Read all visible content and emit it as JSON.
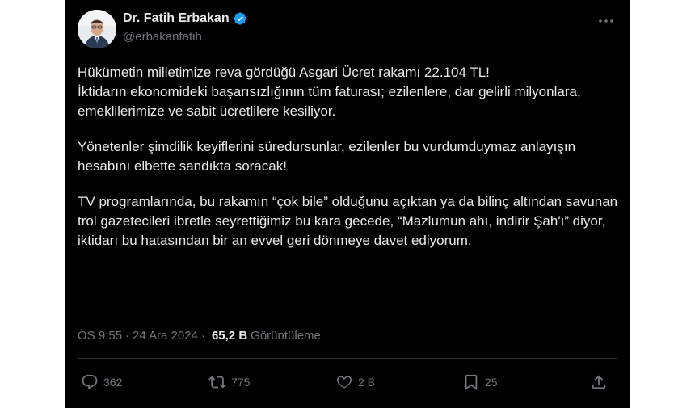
{
  "author": {
    "name": "Dr. Fatih Erbakan",
    "handle": "@erbakanfatih"
  },
  "tweet": {
    "paragraphs": [
      "Hükümetin milletimize reva gördüğü Asgari Ücret rakamı 22.104 TL!\nİktidarın ekonomideki başarısızlığının tüm faturası; ezilenlere, dar gelirli milyonlara, emeklilerimize ve sabit ücretlilere kesiliyor.",
      "Yönetenler şimdilik keyiflerini süredursunlar, ezilenler bu vurdumduymaz anlayışın hesabını elbette sandıkta soracak!",
      "TV programlarında, bu rakamın “çok bile” olduğunu açıktan ya da bilinç altından savunan trol gazetecileri ibretle seyrettiğimiz bu kara gecede, “Mazlumun ahı, indirir Şah'ı” diyor, iktidarı bu hatasından bir an evvel geri dönmeye davet ediyorum."
    ]
  },
  "meta": {
    "time": "ÖS 9:55",
    "separator": "·",
    "date": "24 Ara 2024",
    "views": "65,2 B",
    "views_label": "Görüntüleme"
  },
  "actions": {
    "replies": "362",
    "reposts": "775",
    "likes": "2 B",
    "bookmarks": "25"
  },
  "icons": [
    "verified-badge-icon",
    "more-icon",
    "reply-icon",
    "repost-icon",
    "like-icon",
    "bookmark-icon",
    "share-icon"
  ],
  "colors": {
    "background": "#000000",
    "text": "#e7e9ea",
    "muted": "#71767b",
    "verified": "#1d9bf0",
    "divider": "#2f3336"
  }
}
